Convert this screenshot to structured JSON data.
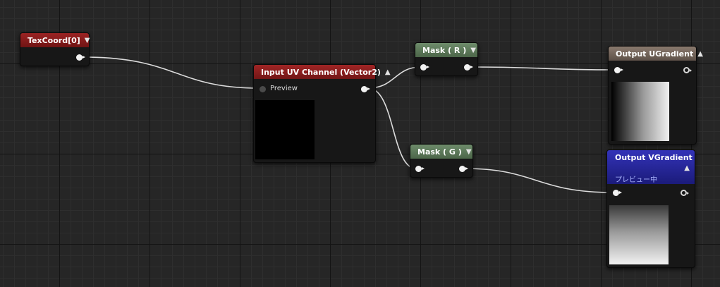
{
  "nodes": {
    "texcoord": {
      "title": "TexCoord[0]"
    },
    "input_uv": {
      "title": "Input UV Channel (Vector2)",
      "pin_label": "Preview"
    },
    "mask_r": {
      "title": "Mask ( R )"
    },
    "mask_g": {
      "title": "Mask ( G )"
    },
    "output_u": {
      "title": "Output UGradient"
    },
    "output_v": {
      "title": "Output VGradient",
      "status": "プレビュー中"
    }
  },
  "colors": {
    "texcoord_header": "#8a1a1a",
    "input_uv_header": "#8e1c1c",
    "mask_header": "#5d7a5b",
    "output_u_header": "#7a6a5e",
    "output_v_header": "#27279a"
  }
}
